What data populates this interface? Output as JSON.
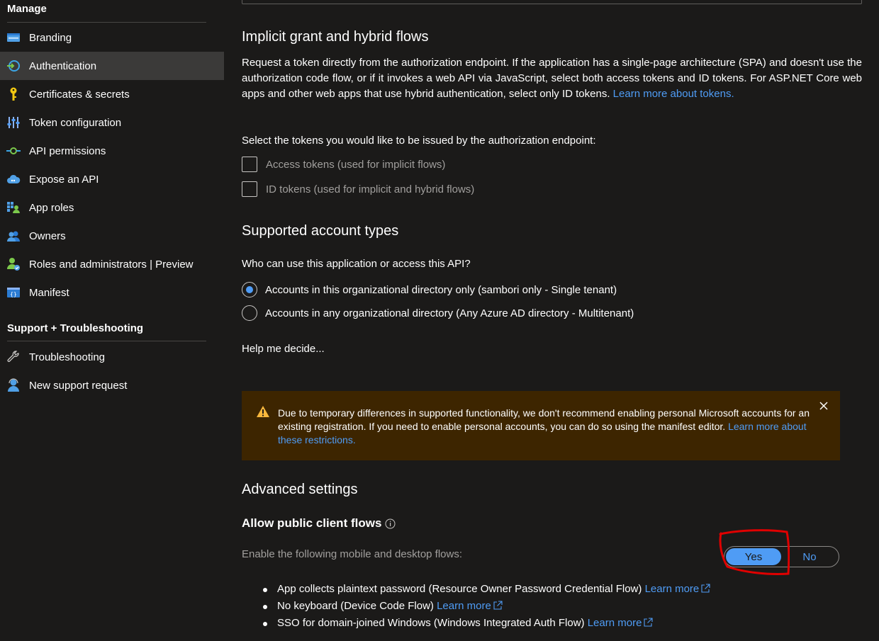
{
  "sidebar": {
    "manage_title": "Manage",
    "items": [
      {
        "label": "Branding",
        "icon": "branding-icon"
      },
      {
        "label": "Authentication",
        "icon": "authentication-icon",
        "selected": true
      },
      {
        "label": "Certificates & secrets",
        "icon": "key-icon"
      },
      {
        "label": "Token configuration",
        "icon": "token-config-icon"
      },
      {
        "label": "API permissions",
        "icon": "api-permissions-icon"
      },
      {
        "label": "Expose an API",
        "icon": "cloud-icon"
      },
      {
        "label": "App roles",
        "icon": "app-roles-icon"
      },
      {
        "label": "Owners",
        "icon": "owners-icon"
      },
      {
        "label": "Roles and administrators | Preview",
        "icon": "roles-admin-icon"
      },
      {
        "label": "Manifest",
        "icon": "manifest-icon"
      }
    ],
    "support_title": "Support + Troubleshooting",
    "support_items": [
      {
        "label": "Troubleshooting",
        "icon": "wrench-icon"
      },
      {
        "label": "New support request",
        "icon": "support-person-icon"
      }
    ]
  },
  "implicit": {
    "title": "Implicit grant and hybrid flows",
    "description": "Request a token directly from the authorization endpoint. If the application has a single-page architecture (SPA) and doesn't use the authorization code flow, or if it invokes a web API via JavaScript, select both access tokens and ID tokens. For ASP.NET Core web apps and other web apps that use hybrid authentication, select only ID tokens.",
    "learn_more": "Learn more about tokens.",
    "select_prompt": "Select the tokens you would like to be issued by the authorization endpoint:",
    "access_tokens": "Access tokens (used for implicit flows)",
    "id_tokens": "ID tokens (used for implicit and hybrid flows)"
  },
  "accounts": {
    "title": "Supported account types",
    "question": "Who can use this application or access this API?",
    "option_single": "Accounts in this organizational directory only (sambori only - Single tenant)",
    "option_multi": "Accounts in any organizational directory (Any Azure AD directory - Multitenant)",
    "help_link": "Help me decide..."
  },
  "warning": {
    "text": "Due to temporary differences in supported functionality, we don't recommend enabling personal Microsoft accounts for an existing registration. If you need to enable personal accounts, you can do so using the manifest editor.",
    "link": "Learn more about these restrictions."
  },
  "advanced": {
    "title": "Advanced settings",
    "public_client_title": "Allow public client flows",
    "enable_label": "Enable the following mobile and desktop flows:",
    "toggle_yes": "Yes",
    "toggle_no": "No",
    "flows": [
      {
        "text": "App collects plaintext password (Resource Owner Password Credential Flow)",
        "link": "Learn more"
      },
      {
        "text": "No keyboard (Device Code Flow)",
        "link": "Learn more"
      },
      {
        "text": "SSO for domain-joined Windows (Windows Integrated Auth Flow)",
        "link": "Learn more"
      }
    ]
  },
  "colors": {
    "background": "#1b1a19",
    "selected_nav": "#3b3a39",
    "link": "#4f9cf5",
    "warning_bg": "#3d2500",
    "annotation": "#e00000"
  }
}
